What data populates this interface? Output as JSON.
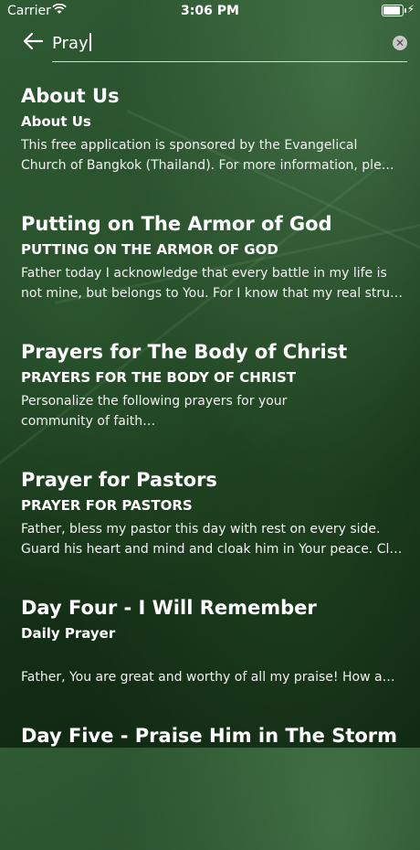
{
  "status_bar": {
    "carrier": "Carrier",
    "time": "3:06 PM",
    "battery_level": 1.0,
    "icons": [
      "wifi-icon",
      "battery-icon",
      "charging-icon"
    ]
  },
  "search": {
    "value": "Pray",
    "back_icon": "arrow-left-icon",
    "clear_icon": "clear-circle-icon"
  },
  "results": [
    {
      "title": "About Us",
      "subtitle": "About Us",
      "snippet": " This free application is sponsored by the Evangelical Church of Bangkok (Thailand). For more information, ple…"
    },
    {
      "title": "Putting on The Armor of God",
      "subtitle": "PUTTING ON THE ARMOR OF GOD",
      "snippet": "Father today I acknowledge that every battle in my life is not mine, but belongs to You. For I know that my real stru…"
    },
    {
      "title": "Prayers for The Body of Christ",
      "subtitle": "PRAYERS FOR THE BODY OF CHRIST",
      "snippet": "Personalize the following prayers for your community of faith…"
    },
    {
      "title": "Prayer for Pastors",
      "subtitle": "PRAYER FOR PASTORS",
      "snippet": "Father, bless my pastor this day with rest on every side. Guard his heart and mind and cloak him in Your peace. Cl…"
    },
    {
      "title": "Day Four - I Will Remember",
      "subtitle": "Daily Prayer",
      "snippet": "Father, You are great and worthy of all my praise! How aw…"
    },
    {
      "title": "Day Five - Praise Him in The Storm",
      "subtitle": "",
      "snippet": ""
    }
  ]
}
